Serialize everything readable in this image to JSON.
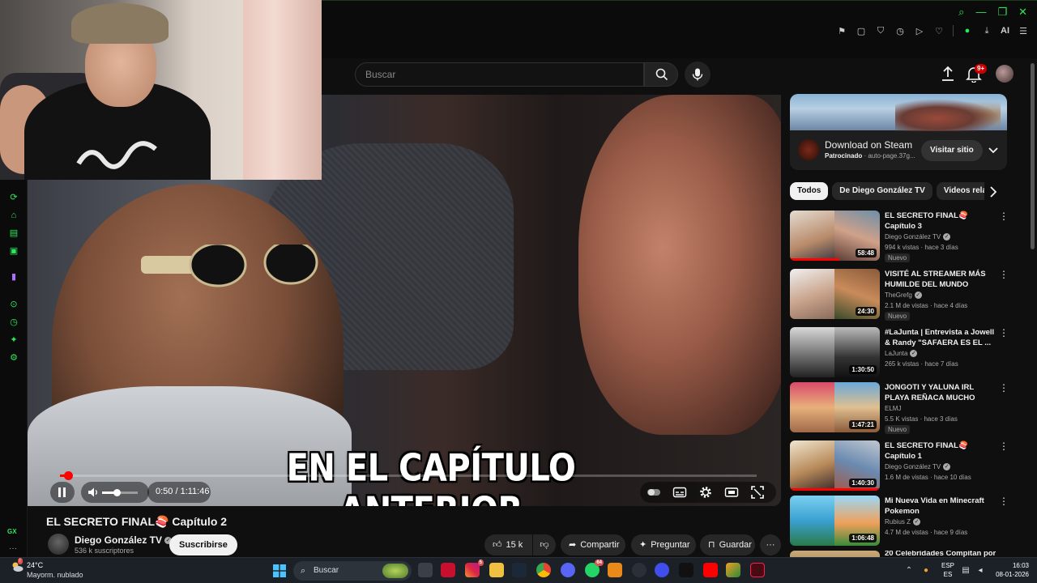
{
  "browser": {
    "toolbar_ai": "AI"
  },
  "search": {
    "placeholder": "Buscar"
  },
  "header": {
    "notifications_count": "9+"
  },
  "player": {
    "caption": "EN EL CAPÍTULO ANTERIOR",
    "time": "0:50 / 1:11:46",
    "progress": 0.012,
    "volume": 0.4
  },
  "gx_sidebar": {
    "label": "GX"
  },
  "video": {
    "title": "EL SECRETO FINAL🍣 Capítulo 2",
    "channel": "Diego González TV",
    "subscribers": "536 k suscriptores",
    "subscribe_label": "Suscribirse",
    "likes": "15 k",
    "share_label": "Compartir",
    "ask_label": "Preguntar",
    "save_label": "Guardar"
  },
  "ad": {
    "title": "Download on Steam",
    "sponsored": "Patrocinado",
    "url": "auto-page.37g...",
    "cta": "Visitar sitio"
  },
  "chips": [
    {
      "label": "Todos",
      "active": true
    },
    {
      "label": "De Diego González TV",
      "active": false
    },
    {
      "label": "Videos relacio",
      "active": false
    }
  ],
  "recommendations": [
    {
      "title": "EL SECRETO FINAL🍣 Capítulo 3",
      "channel": "Diego González TV",
      "views": "994 k vistas · hace 3 días",
      "duration": "58:48",
      "badge": "Nuevo",
      "watched": 0.55
    },
    {
      "title": "VISITÉ AL STREAMER MÁS HUMILDE DEL MUNDO",
      "channel": "TheGrefg",
      "views": "2.1 M de vistas · hace 4 días",
      "duration": "24:30",
      "badge": "Nuevo",
      "watched": 0
    },
    {
      "title": "#LaJunta | Entrevista a Jowell & Randy \"SAFAERA ES EL ...",
      "channel": "LaJunta",
      "views": "265 k vistas · hace 7 días",
      "duration": "1:30:50",
      "badge": "",
      "watched": 0
    },
    {
      "title": "JONGOTI Y YALUNA IRL PLAYA REÑACA MUCHO PELUCHE ...",
      "channel": "ELMJ",
      "views": "5.5 K vistas · hace 3 días",
      "duration": "1:47:21",
      "badge": "Nuevo",
      "watched": 0
    },
    {
      "title": "EL SECRETO FINAL🍣 Capítulo 1",
      "channel": "Diego González TV",
      "views": "1.6 M de vistas · hace 10 días",
      "duration": "1:40:30",
      "badge": "",
      "watched": 1.0
    },
    {
      "title": "Mi Nueva Vida en Minecraft Pokemon",
      "channel": "Rubius Z",
      "views": "4.7 M de vistas · hace 9 días",
      "duration": "1:06:48",
      "badge": "",
      "watched": 0
    },
    {
      "title": "20 Celebridades Compitan por ...",
      "channel": "",
      "views": "",
      "duration": "",
      "badge": "",
      "watched": 0
    }
  ],
  "taskbar": {
    "temperature": "24°C",
    "weather": "Mayorm. nublado",
    "search_label": "Buscar",
    "lang_1": "ESP",
    "lang_2": "ES",
    "time": "16:03",
    "date": "08-01-2026",
    "badge_instagram": "5",
    "badge_discord": "64"
  },
  "colors": {
    "accent_gx": "#2ce75c",
    "yt_red": "#ff0000",
    "background": "#0f0f0f"
  }
}
